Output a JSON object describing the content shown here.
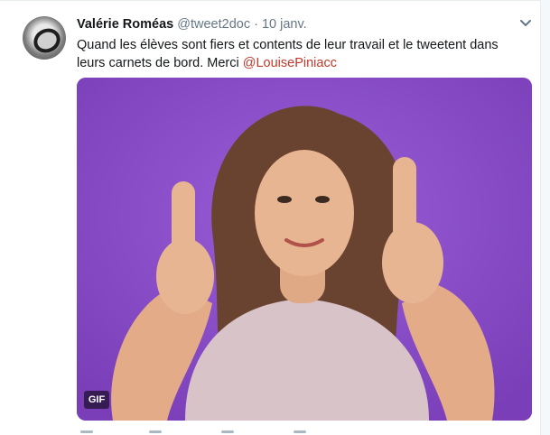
{
  "tweet": {
    "author_name": "Valérie Roméas",
    "handle": "@tweet2doc",
    "separator": "·",
    "date": "10 janv.",
    "text_before": "Quand les élèves sont fiers et contents de leur travail et le tweetent dans leurs carnets de bord. Merci ",
    "mention": "@LouisePiniacc",
    "media": {
      "badge": "GIF",
      "description_icon": "gif-thumbs-up-icon"
    }
  },
  "colors": {
    "accent_mention": "#c0392b",
    "media_background": "#8a4fc6",
    "muted_text": "#657786"
  }
}
